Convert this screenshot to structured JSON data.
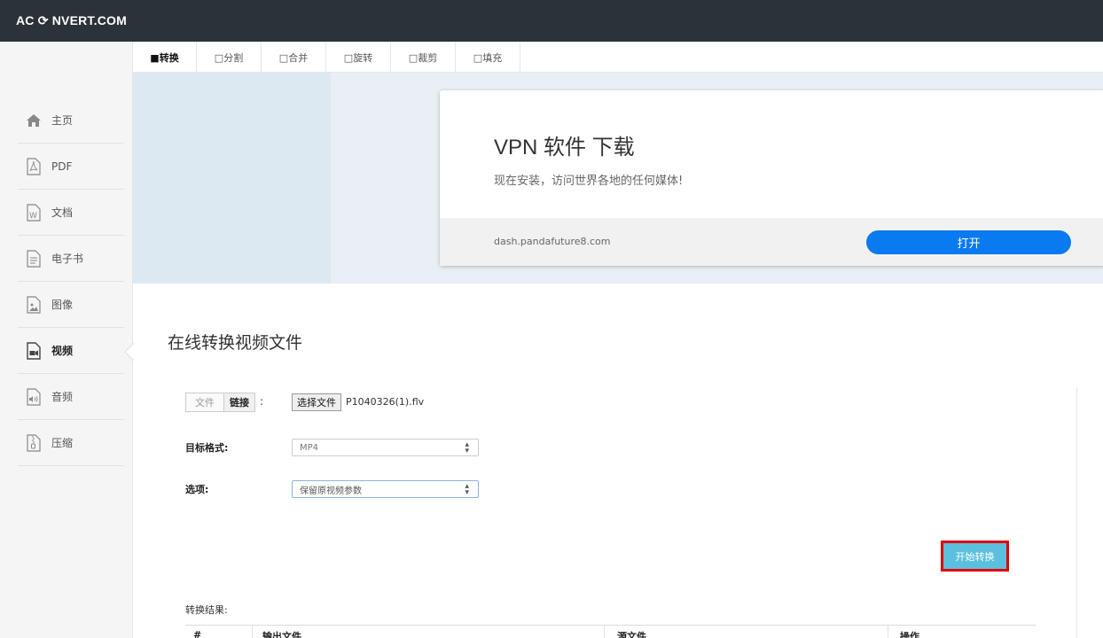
{
  "brand": {
    "logo": "AC ⟳ NVERT.COM"
  },
  "sidebar": {
    "items": [
      {
        "label": "主页",
        "icon": "home-icon"
      },
      {
        "label": "PDF",
        "icon": "pdf-file-icon"
      },
      {
        "label": "文档",
        "icon": "word-doc-icon"
      },
      {
        "label": "电子书",
        "icon": "ebook-icon"
      },
      {
        "label": "图像",
        "icon": "image-file-icon"
      },
      {
        "label": "视频",
        "icon": "video-file-icon"
      },
      {
        "label": "音频",
        "icon": "audio-file-icon"
      },
      {
        "label": "压缩",
        "icon": "archive-file-icon"
      }
    ],
    "active": "视频"
  },
  "tabs": [
    {
      "label": "■转换",
      "active": true
    },
    {
      "label": "□分割"
    },
    {
      "label": "□合并"
    },
    {
      "label": "□旋转"
    },
    {
      "label": "□裁剪"
    },
    {
      "label": "□填充"
    }
  ],
  "ad": {
    "title": "VPN 软件 下载",
    "description": "现在安装，访问世界各地的任何媒体!",
    "domain": "dash.pandafuture8.com",
    "button": "打开"
  },
  "main": {
    "title": "在线转换视频文件",
    "source": {
      "file_tab": "文件",
      "link_tab": "链接",
      "colon": ":"
    },
    "file": {
      "button": "选择文件",
      "name": "P1040326(1).flv"
    },
    "format": {
      "label": "目标格式:",
      "value": "MP4"
    },
    "options": {
      "label": "选项:",
      "value": "保留原视频参数"
    },
    "start_button": "开始转换",
    "results": {
      "label": "转换结果:",
      "columns": [
        "#",
        "输出文件",
        "源文件",
        "操作"
      ]
    }
  },
  "colors": {
    "topbar": "#2a323a",
    "accent": "#0a7af0",
    "start_button": "#5bc0de",
    "highlight": "#e00000"
  }
}
